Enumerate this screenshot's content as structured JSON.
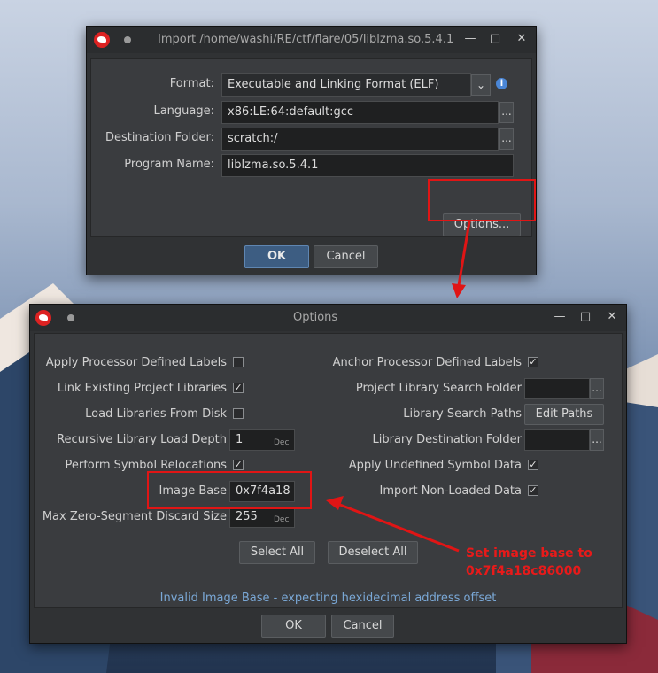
{
  "import_dialog": {
    "title": "Import /home/washi/RE/ctf/flare/05/liblzma.so.5.4.1",
    "format_label": "Format:",
    "format_value": "Executable and Linking Format (ELF)",
    "language_label": "Language:",
    "language_value": "x86:LE:64:default:gcc",
    "destination_label": "Destination Folder:",
    "destination_value": "scratch:/",
    "program_name_label": "Program Name:",
    "program_name_value": "liblzma.so.5.4.1",
    "browse_label": "...",
    "options_button": "Options...",
    "ok_button": "OK",
    "cancel_button": "Cancel",
    "info_icon": "i"
  },
  "options_dialog": {
    "title": "Options",
    "left_options": [
      {
        "label": "Apply Processor Defined Labels",
        "checked": false
      },
      {
        "label": "Link Existing Project Libraries",
        "checked": true
      },
      {
        "label": "Load Libraries From Disk",
        "checked": false
      },
      {
        "label": "Recursive Library Load Depth",
        "value": "1",
        "suffix": "Dec"
      },
      {
        "label": "Perform Symbol Relocations",
        "checked": true
      },
      {
        "label": "Image Base",
        "value": "0x7f4a18"
      },
      {
        "label": "Max Zero-Segment Discard Size",
        "value": "255",
        "suffix": "Dec"
      }
    ],
    "right_options": [
      {
        "label": "Anchor Processor Defined Labels",
        "checked": true
      },
      {
        "label": "Project Library Search Folder",
        "value": ""
      },
      {
        "label": "Library Search Paths",
        "button": "Edit Paths"
      },
      {
        "label": "Library Destination Folder",
        "value": ""
      },
      {
        "label": "Apply Undefined Symbol Data",
        "checked": true
      },
      {
        "label": "Import Non-Loaded Data",
        "checked": true
      }
    ],
    "select_all": "Select All",
    "deselect_all": "Deselect All",
    "status": "Invalid Image Base - expecting hexidecimal address offset",
    "ok_button": "OK",
    "cancel_button": "Cancel",
    "check_mark": "✓"
  },
  "annotation": {
    "line1": "Set image base to",
    "line2": "0x7f4a18c86000"
  },
  "window_controls": {
    "minimize": "—",
    "maximize": "□",
    "close": "✕"
  },
  "colors": {
    "highlight": "#e01515",
    "status_text": "#7aa8d6",
    "accent": "#3d5d82"
  }
}
